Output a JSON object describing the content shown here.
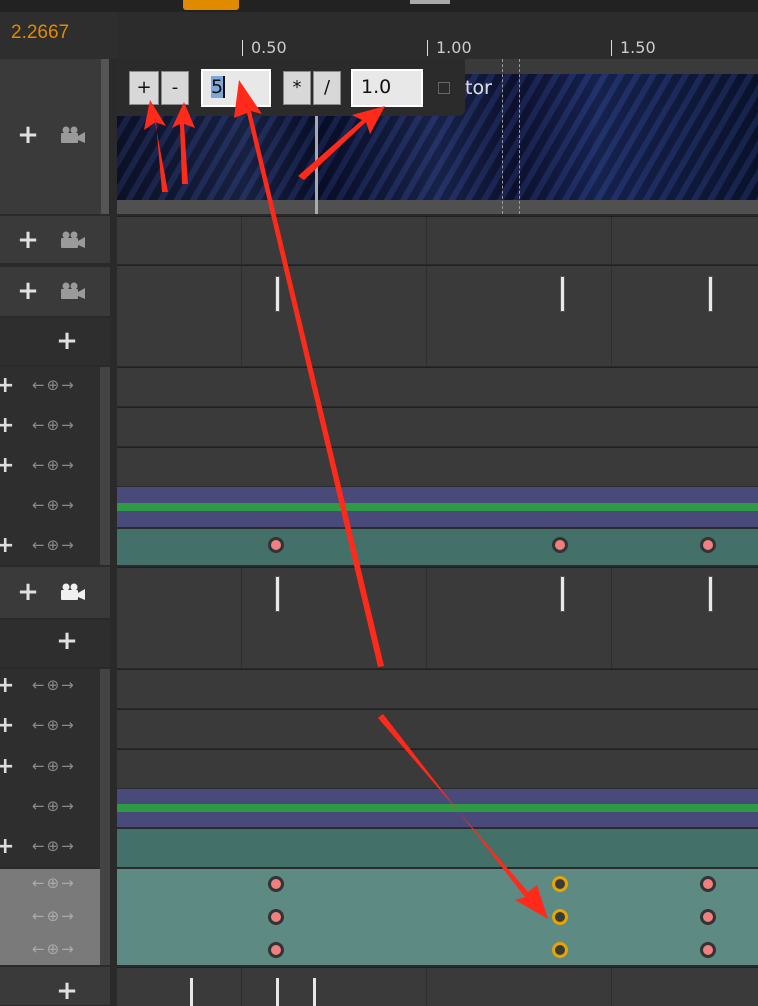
{
  "header": {
    "time_value": "2.2667"
  },
  "ruler": {
    "ticks": [
      "0.50",
      "1.00",
      "1.50"
    ]
  },
  "scale_popup": {
    "plus_label": "+",
    "minus_label": "-",
    "amount_value": "5",
    "multiply_label": "*",
    "divide_label": "/",
    "factor_value": "1.0",
    "background_text": "tor"
  },
  "tracks": {
    "add_glyph": "+",
    "control_arrows": "←⊕→"
  },
  "icons": [
    "plus-icon",
    "camera-icon",
    "arrow-left-icon",
    "circle-plus-icon",
    "arrow-right-icon"
  ],
  "colors": {
    "accent": "#e08a00",
    "keyframe": "#f08080",
    "keyframe_selected_border": "#e6a500",
    "teal_track": "#437068",
    "selected_teal_track": "#5d8a82",
    "purple_band": "#4a4a7a",
    "green_band": "#2f9a46",
    "annotation_arrow": "#ff2a1a"
  }
}
